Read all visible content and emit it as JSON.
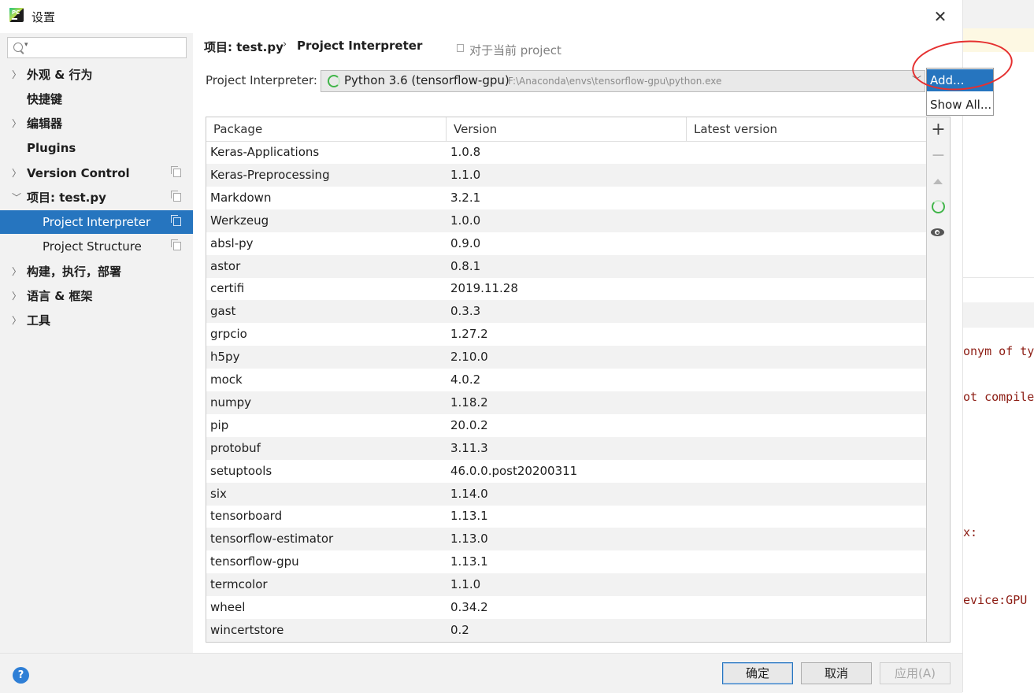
{
  "window": {
    "title": "设置"
  },
  "sidebar": {
    "search_placeholder": "",
    "items": [
      {
        "label": "外观 & 行为",
        "expandable": true
      },
      {
        "label": "快捷键",
        "expandable": false
      },
      {
        "label": "编辑器",
        "expandable": true
      },
      {
        "label": "Plugins",
        "expandable": false
      },
      {
        "label": "Version Control",
        "expandable": true
      },
      {
        "label": "项目: test.py",
        "expandable": true,
        "expanded": true
      },
      {
        "label": "Project Interpreter",
        "selected": true
      },
      {
        "label": "Project Structure"
      },
      {
        "label": "构建，执行，部署",
        "expandable": true
      },
      {
        "label": "语言 & 框架",
        "expandable": true
      },
      {
        "label": "工具",
        "expandable": true
      }
    ]
  },
  "breadcrumb": {
    "part1": "项目: test.py",
    "separator": "›",
    "part2": "Project Interpreter"
  },
  "for_current_project": "对于当前 project",
  "interpreter": {
    "label": "Project Interpreter:",
    "name": "Python 3.6 (tensorflow-gpu)",
    "path": "F:\\Anaconda\\envs\\tensorflow-gpu\\python.exe"
  },
  "popup": {
    "add": "Add...",
    "show_all": "Show All..."
  },
  "table": {
    "headers": [
      "Package",
      "Version",
      "Latest version"
    ],
    "rows": [
      [
        "Keras-Applications",
        "1.0.8",
        ""
      ],
      [
        "Keras-Preprocessing",
        "1.1.0",
        ""
      ],
      [
        "Markdown",
        "3.2.1",
        ""
      ],
      [
        "Werkzeug",
        "1.0.0",
        ""
      ],
      [
        "absl-py",
        "0.9.0",
        ""
      ],
      [
        "astor",
        "0.8.1",
        ""
      ],
      [
        "certifi",
        "2019.11.28",
        ""
      ],
      [
        "gast",
        "0.3.3",
        ""
      ],
      [
        "grpcio",
        "1.27.2",
        ""
      ],
      [
        "h5py",
        "2.10.0",
        ""
      ],
      [
        "mock",
        "4.0.2",
        ""
      ],
      [
        "numpy",
        "1.18.2",
        ""
      ],
      [
        "pip",
        "20.0.2",
        ""
      ],
      [
        "protobuf",
        "3.11.3",
        ""
      ],
      [
        "setuptools",
        "46.0.0.post20200311",
        ""
      ],
      [
        "six",
        "1.14.0",
        ""
      ],
      [
        "tensorboard",
        "1.13.1",
        ""
      ],
      [
        "tensorflow-estimator",
        "1.13.0",
        ""
      ],
      [
        "tensorflow-gpu",
        "1.13.1",
        ""
      ],
      [
        "termcolor",
        "1.1.0",
        ""
      ],
      [
        "wheel",
        "0.34.2",
        ""
      ],
      [
        "wincertstore",
        "0.2",
        ""
      ]
    ]
  },
  "buttons": {
    "ok": "确定",
    "cancel": "取消",
    "apply": "应用(A)"
  },
  "background_code": [
    "onym of ty",
    "ot compile",
    "x:",
    "evice:GPU"
  ],
  "colors": {
    "accent": "#2675bf",
    "highlight_circle": "#e53030",
    "loading": "#40b549"
  }
}
